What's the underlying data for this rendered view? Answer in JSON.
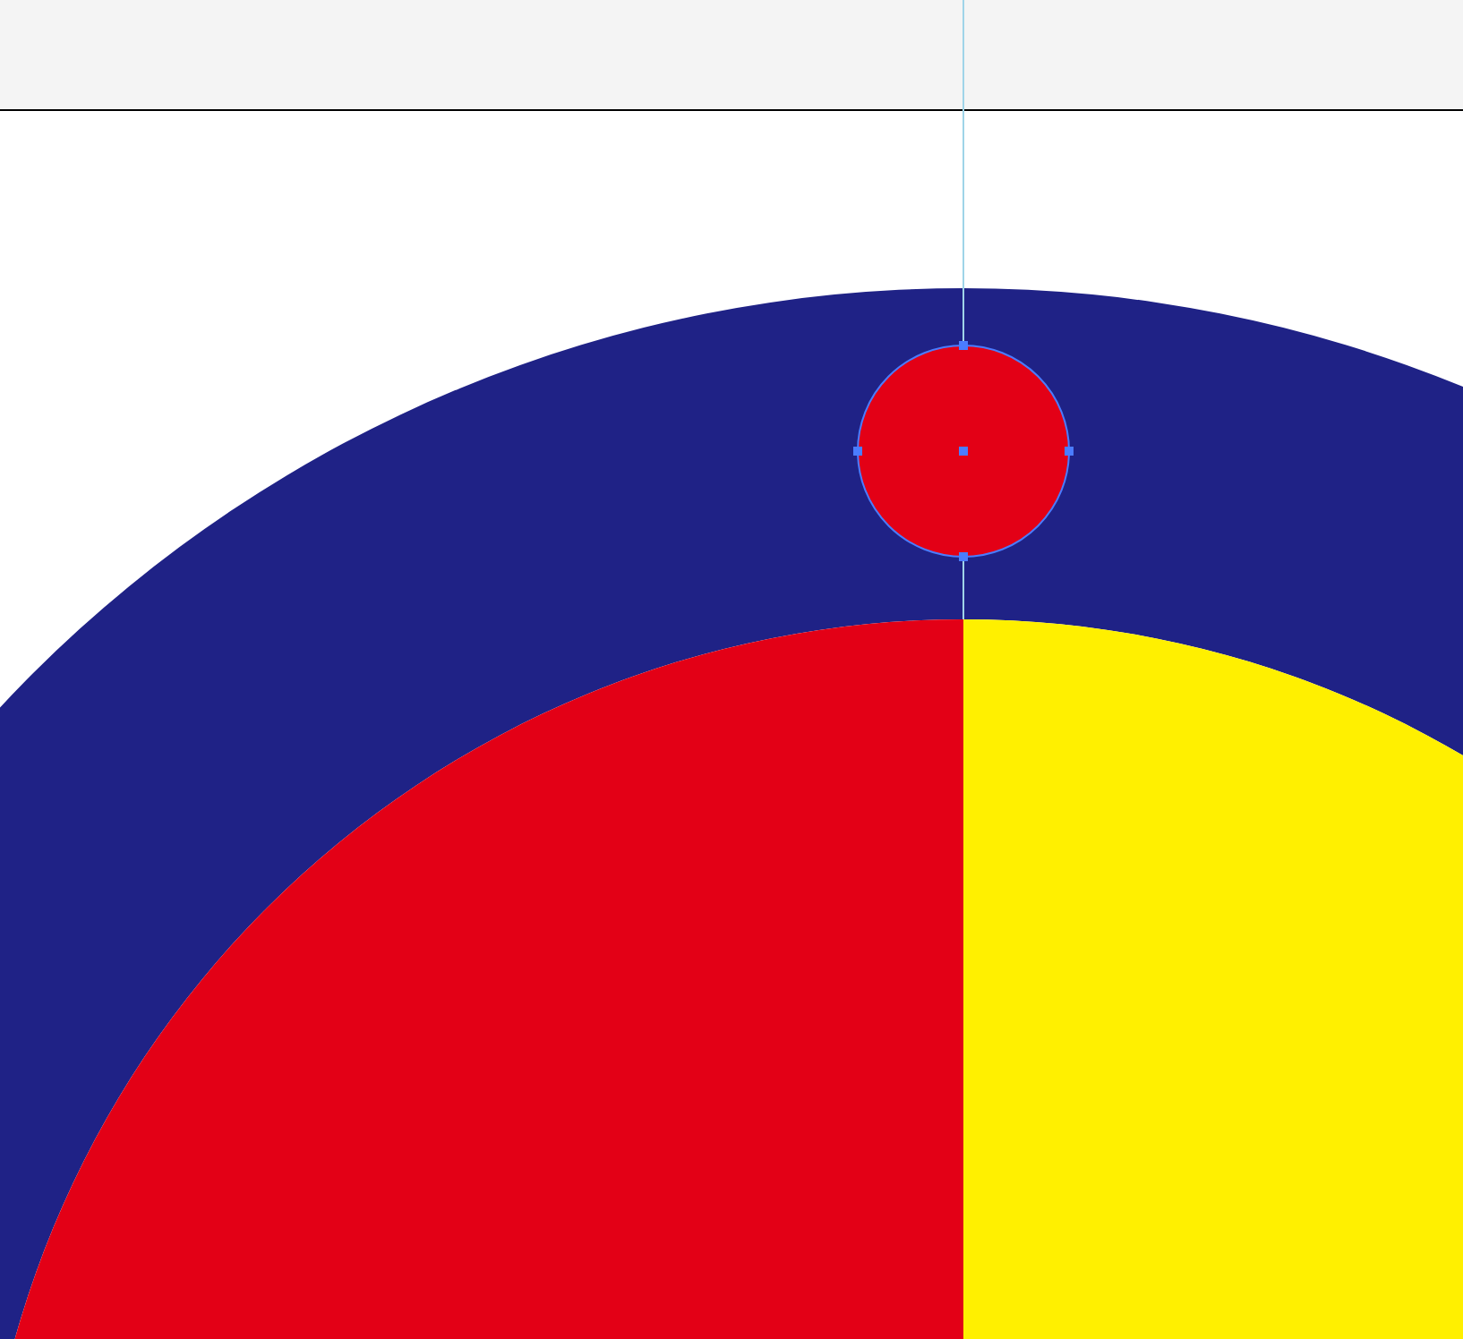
{
  "shapes": [
    {
      "kind": "ring",
      "color": "#1f2286"
    },
    {
      "kind": "left-half",
      "color": "#e30016"
    },
    {
      "kind": "right-half",
      "color": "#fff000"
    },
    {
      "kind": "dot",
      "color": "#e30016",
      "selected": true
    }
  ]
}
